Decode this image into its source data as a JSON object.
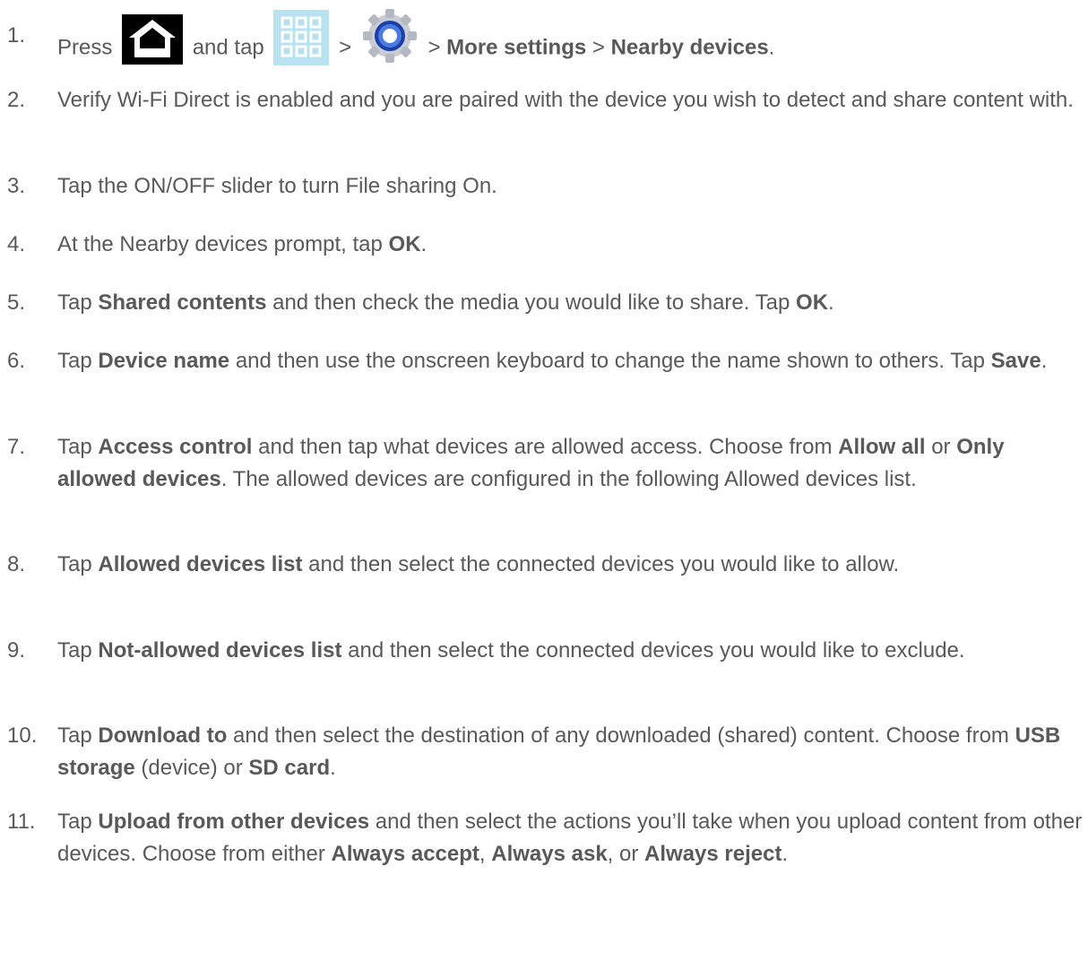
{
  "step1": {
    "num": "1.",
    "press": "Press",
    "and_tap": "and tap",
    "sep1": ">",
    "sep2": ">",
    "more_settings": "More settings",
    "sep3": ">",
    "nearby_devices": "Nearby devices",
    "end": "."
  },
  "step2": {
    "num": "2.",
    "text": "Verify Wi-Fi Direct is enabled and you are paired with the device you wish to detect and share content with."
  },
  "step3": {
    "num": "3.",
    "text": "Tap the ON/OFF slider to turn File sharing On."
  },
  "step4": {
    "num": "4.",
    "text": "At the Nearby devices prompt, tap",
    "ok": "OK",
    "end": "."
  },
  "step5": {
    "num": "5.",
    "tap": "Tap",
    "shared_contents": "Shared contents",
    "mid": "and then check the media you would like to share. Tap",
    "ok": "OK",
    "end": "."
  },
  "step6": {
    "num": "6.",
    "tap": "Tap",
    "device_name": "Device name",
    "mid": "and then use the onscreen keyboard to change the name shown to others. Tap",
    "save": "Save",
    "end": "."
  },
  "step7": {
    "num": "7.",
    "tap": "Tap",
    "access_control": "Access control",
    "mid": "and then tap what devices are allowed access. Choose from",
    "allow_all": "Allow all",
    "or": "or",
    "only_allowed": "Only allowed devices",
    "end": ". The allowed devices are configured in the following Allowed devices list."
  },
  "step8": {
    "num": "8.",
    "tap": "Tap",
    "allowed_list": "Allowed devices list",
    "end": "and then select the connected devices you would like to allow."
  },
  "step9": {
    "num": "9.",
    "tap": "Tap",
    "not_allowed_list": "Not-allowed devices list",
    "end": "and then select the connected devices you would like to exclude."
  },
  "step10": {
    "num": "10.",
    "tap": "Tap",
    "download_to": "Download to",
    "mid": "and then select the destination of any downloaded (shared) content. Choose from",
    "usb": "USB storage",
    "mid2": "(device) or",
    "sd": "SD card",
    "end": "."
  },
  "step11": {
    "num": "11.",
    "tap": "Tap",
    "upload": "Upload from other devices",
    "mid": "and then select the actions you’ll take when you upload content from other devices. Choose from either",
    "accept": "Always accept",
    "comma1": ",",
    "ask": "Always ask",
    "comma2": ", or",
    "reject": "Always reject",
    "end": "."
  },
  "icons": [
    "home-icon",
    "apps-icon",
    "settings-icon"
  ]
}
